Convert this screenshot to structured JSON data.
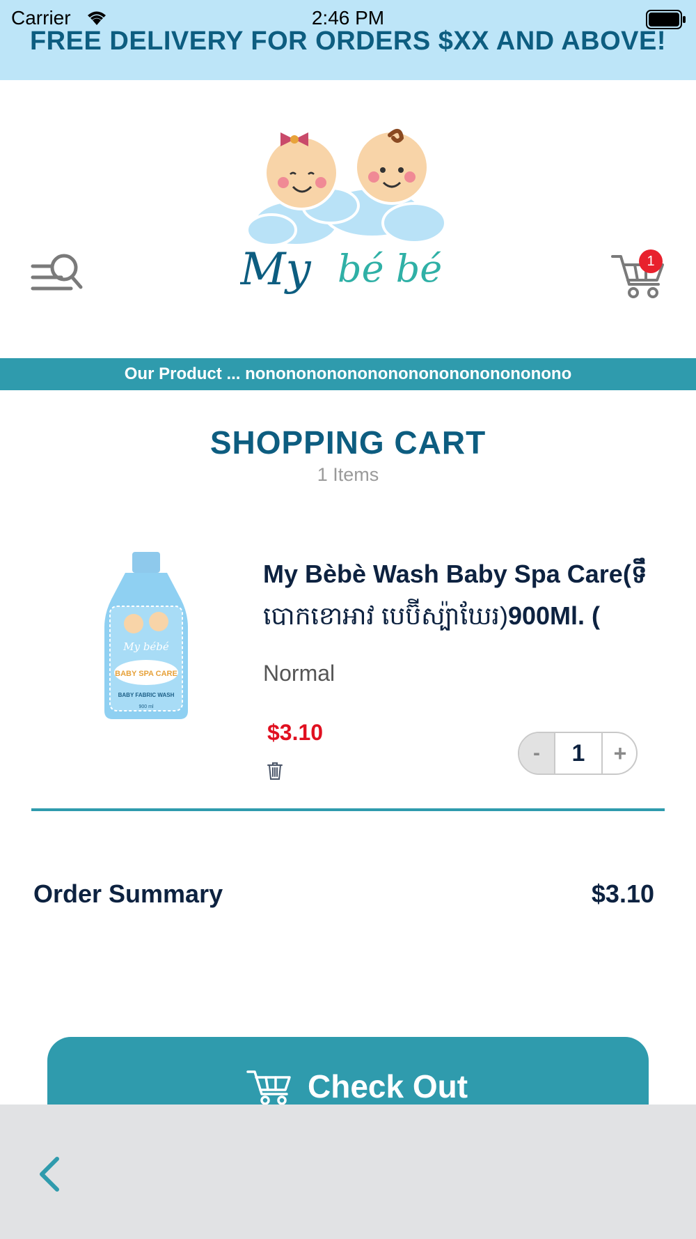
{
  "status_bar": {
    "carrier": "Carrier",
    "time": "2:46 PM"
  },
  "promo": {
    "text": "FREE DELIVERY FOR ORDERS $XX AND ABOVE!"
  },
  "header": {
    "logo_alt": "My bé bé",
    "cart_badge": "1"
  },
  "marquee": {
    "text": "Our Product ... nononononononononononononononono"
  },
  "cart": {
    "title": "SHOPPING CART",
    "count_label": "1 Items"
  },
  "product": {
    "name_line1": "My Bèbè Wash Baby Spa Care(ទឹ",
    "name_line2_khmer": "បោកខោអាវ  បេប៊ីស្ប៉ាឃែរ)",
    "name_line2_suffix": "900Ml. (",
    "variant": "Normal",
    "price": "$3.10",
    "quantity": "1",
    "minus_label": "-",
    "plus_label": "+",
    "label_brand": "My bébé",
    "label_title": "BABY SPA CARE",
    "label_sub": "BABY FABRIC WASH",
    "label_volume": "900 ml"
  },
  "summary": {
    "label": "Order Summary",
    "value": "$3.10"
  },
  "checkout": {
    "label": "Check Out"
  },
  "colors": {
    "banner_bg": "#bde5f8",
    "brand_teal": "#2f9bad",
    "brand_dark_blue": "#0d5d80",
    "price_red": "#e01020",
    "badge_red": "#e8212d"
  }
}
